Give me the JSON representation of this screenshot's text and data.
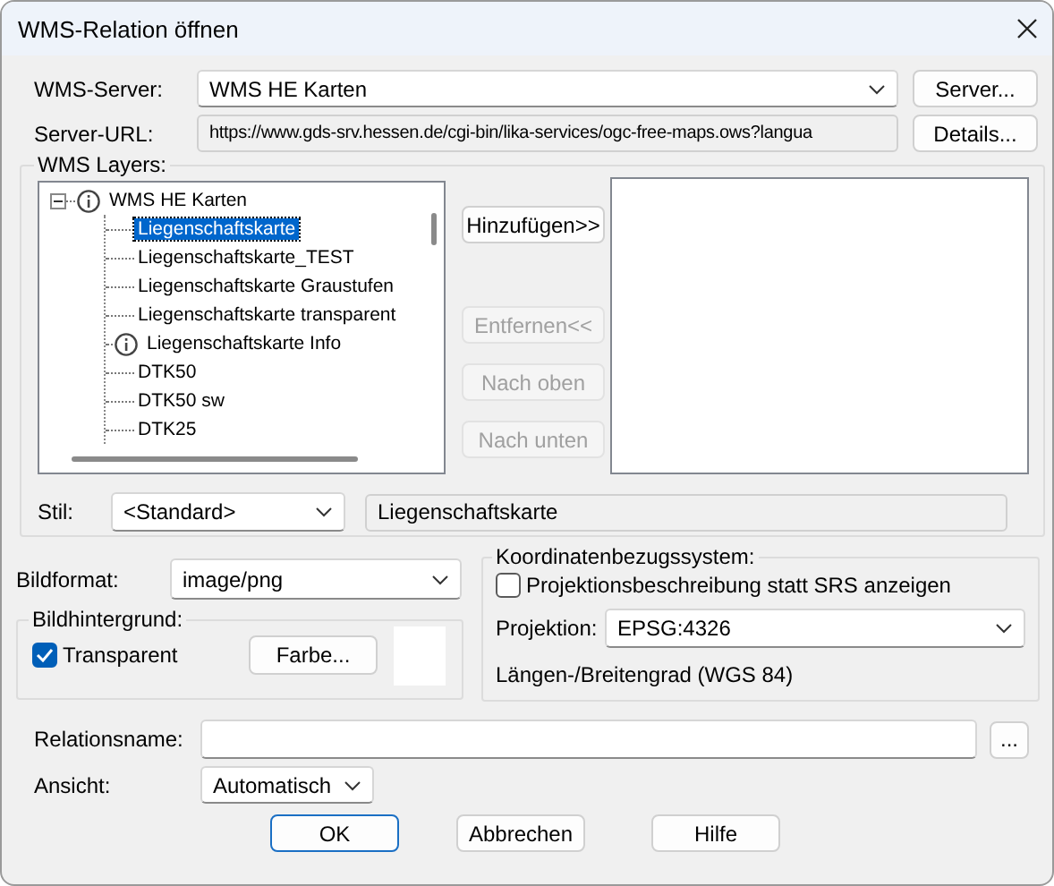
{
  "window": {
    "title": "WMS-Relation öffnen"
  },
  "server": {
    "label": "WMS-Server:",
    "value": "WMS HE Karten",
    "button": "Server..."
  },
  "url": {
    "label": "Server-URL:",
    "value": "https://www.gds-srv.hessen.de/cgi-bin/lika-services/ogc-free-maps.ows?langua",
    "button": "Details..."
  },
  "layers": {
    "label": "WMS Layers:",
    "tree": [
      {
        "label": "WMS HE Karten",
        "kind": "info",
        "expanded": true,
        "selected": false,
        "children": [
          {
            "label": "Liegenschaftskarte",
            "kind": "layer",
            "selected": true
          },
          {
            "label": "Liegenschaftskarte_TEST",
            "kind": "layer",
            "selected": false
          },
          {
            "label": "Liegenschaftskarte Graustufen",
            "kind": "layer",
            "selected": false
          },
          {
            "label": "Liegenschaftskarte transparent",
            "kind": "layer",
            "selected": false
          },
          {
            "label": "Liegenschaftskarte Info",
            "kind": "info",
            "selected": false
          },
          {
            "label": "DTK50",
            "kind": "layer",
            "selected": false
          },
          {
            "label": "DTK50 sw",
            "kind": "layer",
            "selected": false
          },
          {
            "label": "DTK25",
            "kind": "layer",
            "selected": false
          }
        ]
      }
    ],
    "buttons": [
      {
        "label": "Hinzufügen>>",
        "disabled": false
      },
      {
        "label": "Entfernen<<",
        "disabled": true
      },
      {
        "label": "Nach oben",
        "disabled": true
      },
      {
        "label": "Nach unten",
        "disabled": true
      }
    ],
    "style": {
      "label": "Stil:",
      "value": "<Standard>",
      "layer": "Liegenschaftskarte"
    }
  },
  "format": {
    "label": "Bildformat:",
    "value": "image/png"
  },
  "background": {
    "label": "Bildhintergrund:",
    "transparent": {
      "label": "Transparent",
      "checked": true
    },
    "color_button": "Farbe..."
  },
  "crs": {
    "label": "Koordinatenbezugssystem:",
    "show_description": {
      "label": "Projektionsbeschreibung statt SRS anzeigen",
      "checked": false
    },
    "projection_label": "Projektion:",
    "projection": "EPSG:4326",
    "description": "Längen-/Breitengrad (WGS 84)"
  },
  "relation": {
    "label": "Relationsname:",
    "browse": "..."
  },
  "view": {
    "label": "Ansicht:",
    "value": "Automatisch"
  },
  "buttons": [
    {
      "label": "OK",
      "default": true
    },
    {
      "label": "Abbrechen",
      "default": false
    },
    {
      "label": "Hilfe",
      "default": false
    }
  ]
}
